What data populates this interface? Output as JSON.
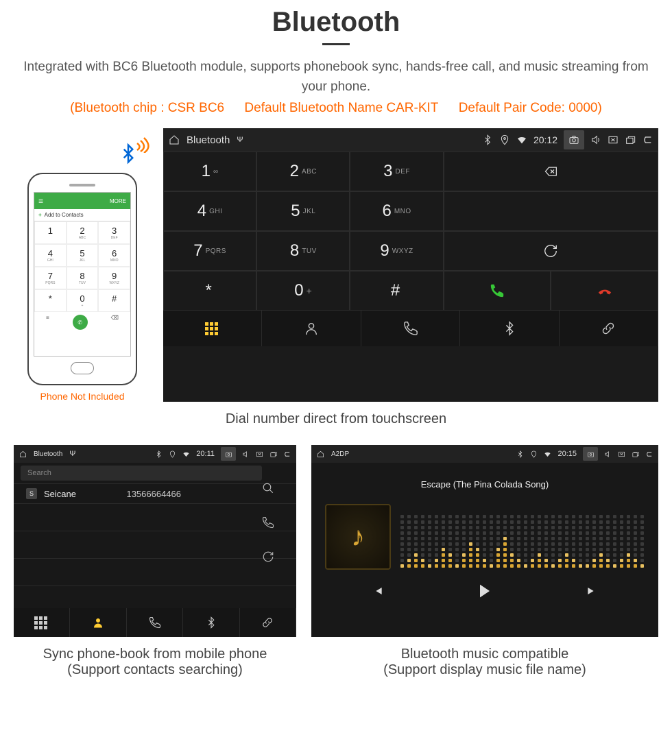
{
  "header": {
    "title": "Bluetooth"
  },
  "subtitle": "Integrated with BC6 Bluetooth module, supports phonebook sync, hands-free call, and music streaming from your phone.",
  "highlight": {
    "chip": "(Bluetooth chip : CSR BC6",
    "name": "Default Bluetooth Name CAR-KIT",
    "pair": "Default Pair Code: 0000)"
  },
  "phone": {
    "not_included": "Phone Not Included",
    "add_contact": "Add to Contacts",
    "menu": "MORE",
    "keys": [
      {
        "n": "1",
        "l": ""
      },
      {
        "n": "2",
        "l": "ABC"
      },
      {
        "n": "3",
        "l": "DEF"
      },
      {
        "n": "4",
        "l": "GHI"
      },
      {
        "n": "5",
        "l": "JKL"
      },
      {
        "n": "6",
        "l": "MNO"
      },
      {
        "n": "7",
        "l": "PQRS"
      },
      {
        "n": "8",
        "l": "TUV"
      },
      {
        "n": "9",
        "l": "WXYZ"
      },
      {
        "n": "*",
        "l": ""
      },
      {
        "n": "0",
        "l": "+"
      },
      {
        "n": "#",
        "l": ""
      }
    ]
  },
  "main_device": {
    "app_name": "Bluetooth",
    "time": "20:12",
    "keys": [
      {
        "n": "1",
        "l": "∞"
      },
      {
        "n": "2",
        "l": "ABC"
      },
      {
        "n": "3",
        "l": "DEF"
      },
      {
        "n": "4",
        "l": "GHI"
      },
      {
        "n": "5",
        "l": "JKL"
      },
      {
        "n": "6",
        "l": "MNO"
      },
      {
        "n": "7",
        "l": "PQRS"
      },
      {
        "n": "8",
        "l": "TUV"
      },
      {
        "n": "9",
        "l": "WXYZ"
      },
      {
        "n": "*",
        "l": ""
      },
      {
        "n": "0",
        "l": "+"
      },
      {
        "n": "#",
        "l": ""
      }
    ]
  },
  "caption1": "Dial number direct from touchscreen",
  "phonebook": {
    "app_name": "Bluetooth",
    "time": "20:11",
    "search_placeholder": "Search",
    "contact_badge": "S",
    "contact_name": "Seicane",
    "contact_number": "13566664466",
    "caption_line1": "Sync phone-book from mobile phone",
    "caption_line2": "(Support contacts searching)"
  },
  "music": {
    "app_name": "A2DP",
    "time": "20:15",
    "song": "Escape (The Pina Colada Song)",
    "eq_heights": [
      1,
      2,
      3,
      2,
      1,
      2,
      4,
      3,
      1,
      3,
      5,
      4,
      2,
      1,
      4,
      6,
      3,
      2,
      1,
      2,
      3,
      2,
      1,
      2,
      3,
      2,
      1,
      1,
      2,
      3,
      2,
      1,
      2,
      3,
      2,
      1
    ],
    "caption_line1": "Bluetooth music compatible",
    "caption_line2": "(Support display music file name)"
  }
}
